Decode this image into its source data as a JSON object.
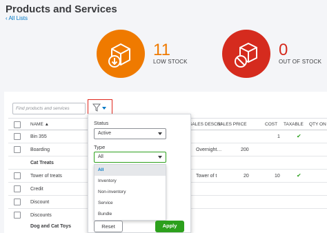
{
  "header": {
    "title": "Products and Services",
    "back_link": "All Lists"
  },
  "stock": {
    "low": {
      "count": "11",
      "label": "LOW STOCK",
      "icon": "box-down-arrow-icon",
      "color": "#ef7a00"
    },
    "out": {
      "count": "0",
      "label": "OUT OF STOCK",
      "icon": "box-no-icon",
      "color": "#d52b1e"
    }
  },
  "search": {
    "placeholder": "Find products and services"
  },
  "table": {
    "columns": [
      "NAME ▲",
      "SALES DESCRI",
      "SALES PRICE",
      "COST",
      "TAXABLE",
      "QTY ON"
    ],
    "rows": [
      {
        "name": "Bin 355",
        "desc": "",
        "price": "",
        "cost": "1",
        "taxable": "✔",
        "group": false
      },
      {
        "name": "Boarding",
        "desc": "Overnight…",
        "price": "200",
        "cost": "",
        "taxable": "",
        "group": false
      },
      {
        "name": "Cat Treats",
        "desc": "",
        "price": "",
        "cost": "",
        "taxable": "",
        "group": true
      },
      {
        "name": "Tower of treats",
        "desc": "Tower of t",
        "price": "20",
        "cost": "10",
        "taxable": "✔",
        "group": false
      },
      {
        "name": "Credit",
        "desc": "",
        "price": "",
        "cost": "",
        "taxable": "",
        "group": false
      },
      {
        "name": "Discount",
        "desc": "",
        "price": "",
        "cost": "",
        "taxable": "",
        "group": false
      },
      {
        "name": "Discounts",
        "desc": "",
        "price": "",
        "cost": "",
        "taxable": "",
        "group": false
      },
      {
        "name": "Dog and Cat Toys",
        "desc": "",
        "price": "",
        "cost": "",
        "taxable": "",
        "group": true
      }
    ]
  },
  "filter": {
    "status_label": "Status",
    "status_value": "Active",
    "type_label": "Type",
    "type_value": "All",
    "type_options": [
      "All",
      "Inventory",
      "Non-inventory",
      "Service",
      "Bundle"
    ],
    "reset_label": "Reset",
    "apply_label": "Apply",
    "accent": "#2ca01c"
  }
}
